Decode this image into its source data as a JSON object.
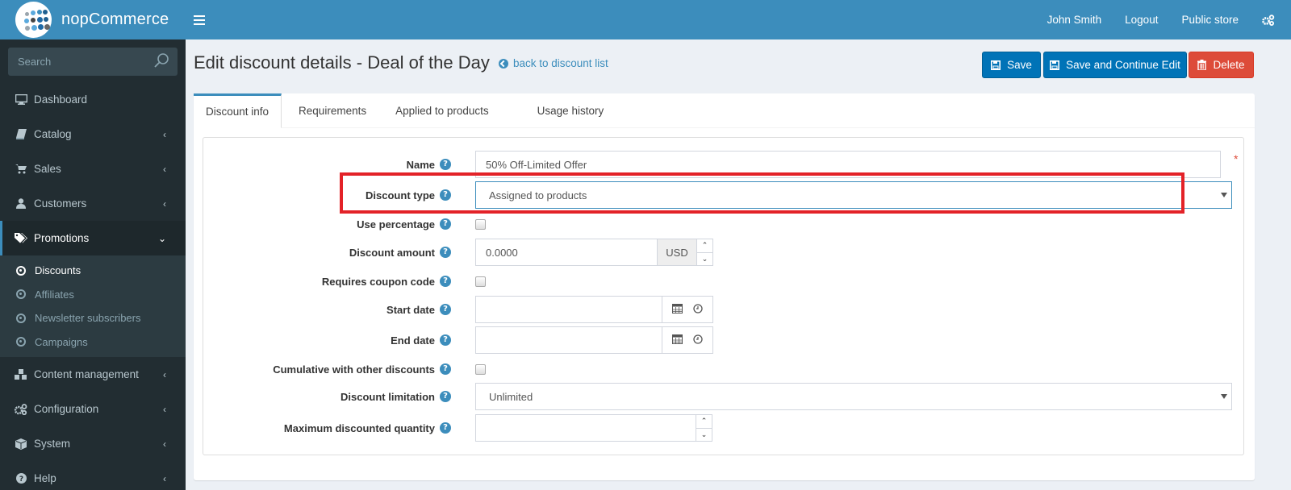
{
  "app": {
    "brand": "nopCommerce"
  },
  "sidebar": {
    "search_placeholder": "Search",
    "items": [
      {
        "label": "Dashboard",
        "icon": "desktop-icon",
        "has_chevron": false
      },
      {
        "label": "Catalog",
        "icon": "book-icon",
        "has_chevron": true
      },
      {
        "label": "Sales",
        "icon": "cart-icon",
        "has_chevron": true
      },
      {
        "label": "Customers",
        "icon": "user-icon",
        "has_chevron": true
      },
      {
        "label": "Promotions",
        "icon": "tags-icon",
        "has_chevron": true,
        "active": true,
        "expanded": true
      },
      {
        "label": "Content management",
        "icon": "cubes-icon",
        "has_chevron": true
      },
      {
        "label": "Configuration",
        "icon": "gears-icon",
        "has_chevron": true
      },
      {
        "label": "System",
        "icon": "cube-icon",
        "has_chevron": true
      },
      {
        "label": "Help",
        "icon": "question-icon",
        "has_chevron": true
      }
    ],
    "promotions_sub": [
      {
        "label": "Discounts",
        "active": true
      },
      {
        "label": "Affiliates"
      },
      {
        "label": "Newsletter subscribers"
      },
      {
        "label": "Campaigns"
      }
    ]
  },
  "header": {
    "user": "John Smith",
    "logout": "Logout",
    "public_store": "Public store"
  },
  "page": {
    "title": "Edit discount details - Deal of the Day",
    "back_link": "back to discount list",
    "buttons": {
      "save": "Save",
      "save_continue": "Save and Continue Edit",
      "delete": "Delete"
    },
    "tabs": [
      "Discount info",
      "Requirements",
      "Applied to products",
      "Usage history"
    ],
    "active_tab": "Discount info"
  },
  "form": {
    "name": {
      "label": "Name",
      "value": "50% Off-Limited Offer",
      "required": true,
      "required_mark": "*"
    },
    "discount_type": {
      "label": "Discount type",
      "value": "Assigned to products"
    },
    "use_percentage": {
      "label": "Use percentage",
      "checked": false
    },
    "discount_amount": {
      "label": "Discount amount",
      "value": "0.0000",
      "currency": "USD"
    },
    "requires_coupon": {
      "label": "Requires coupon code",
      "checked": false
    },
    "start_date": {
      "label": "Start date",
      "value": ""
    },
    "end_date": {
      "label": "End date",
      "value": ""
    },
    "cumulative": {
      "label": "Cumulative with other discounts",
      "checked": false
    },
    "discount_limitation": {
      "label": "Discount limitation",
      "value": "Unlimited"
    },
    "max_discounted_qty": {
      "label": "Maximum discounted quantity",
      "value": ""
    },
    "help_glyph": "?"
  },
  "colors": {
    "brand": "#3c8dbc",
    "primary_button": "#0073b7",
    "danger_button": "#dd4b39",
    "highlight_box": "#e32228",
    "sidebar_bg": "#222d32"
  }
}
